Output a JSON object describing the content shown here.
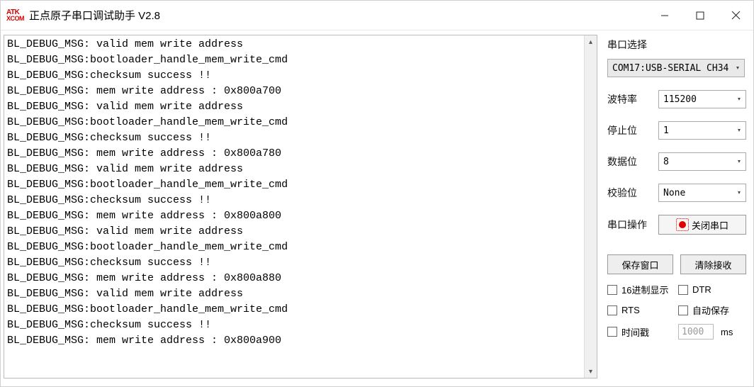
{
  "window": {
    "title": "正点原子串口调试助手 V2.8",
    "logo_top": "ATK",
    "logo_bot": "XCOM"
  },
  "log_lines": [
    "BL_DEBUG_MSG: valid mem write address",
    "BL_DEBUG_MSG:bootloader_handle_mem_write_cmd",
    "BL_DEBUG_MSG:checksum success !!",
    "BL_DEBUG_MSG: mem write address : 0x800a700",
    "BL_DEBUG_MSG: valid mem write address",
    "BL_DEBUG_MSG:bootloader_handle_mem_write_cmd",
    "BL_DEBUG_MSG:checksum success !!",
    "BL_DEBUG_MSG: mem write address : 0x800a780",
    "BL_DEBUG_MSG: valid mem write address",
    "BL_DEBUG_MSG:bootloader_handle_mem_write_cmd",
    "BL_DEBUG_MSG:checksum success !!",
    "BL_DEBUG_MSG: mem write address : 0x800a800",
    "BL_DEBUG_MSG: valid mem write address",
    "BL_DEBUG_MSG:bootloader_handle_mem_write_cmd",
    "BL_DEBUG_MSG:checksum success !!",
    "BL_DEBUG_MSG: mem write address : 0x800a880",
    "BL_DEBUG_MSG: valid mem write address",
    "BL_DEBUG_MSG:bootloader_handle_mem_write_cmd",
    "BL_DEBUG_MSG:checksum success !!",
    "BL_DEBUG_MSG: mem write address : 0x800a900"
  ],
  "side": {
    "section_title": "串口选择",
    "port": "COM17:USB-SERIAL CH34",
    "rows": {
      "baud_label": "波特率",
      "baud_value": "115200",
      "stop_label": "停止位",
      "stop_value": "1",
      "data_label": "数据位",
      "data_value": "8",
      "parity_label": "校验位",
      "parity_value": "None",
      "op_label": "串口操作",
      "op_button": "关闭串口"
    },
    "buttons": {
      "save_window": "保存窗口",
      "clear_recv": "清除接收"
    },
    "checks": {
      "hex_display": "16进制显示",
      "dtr": "DTR",
      "rts": "RTS",
      "autosave": "自动保存",
      "timestamp": "时间戳",
      "ts_value": "1000",
      "ts_unit": "ms"
    }
  }
}
